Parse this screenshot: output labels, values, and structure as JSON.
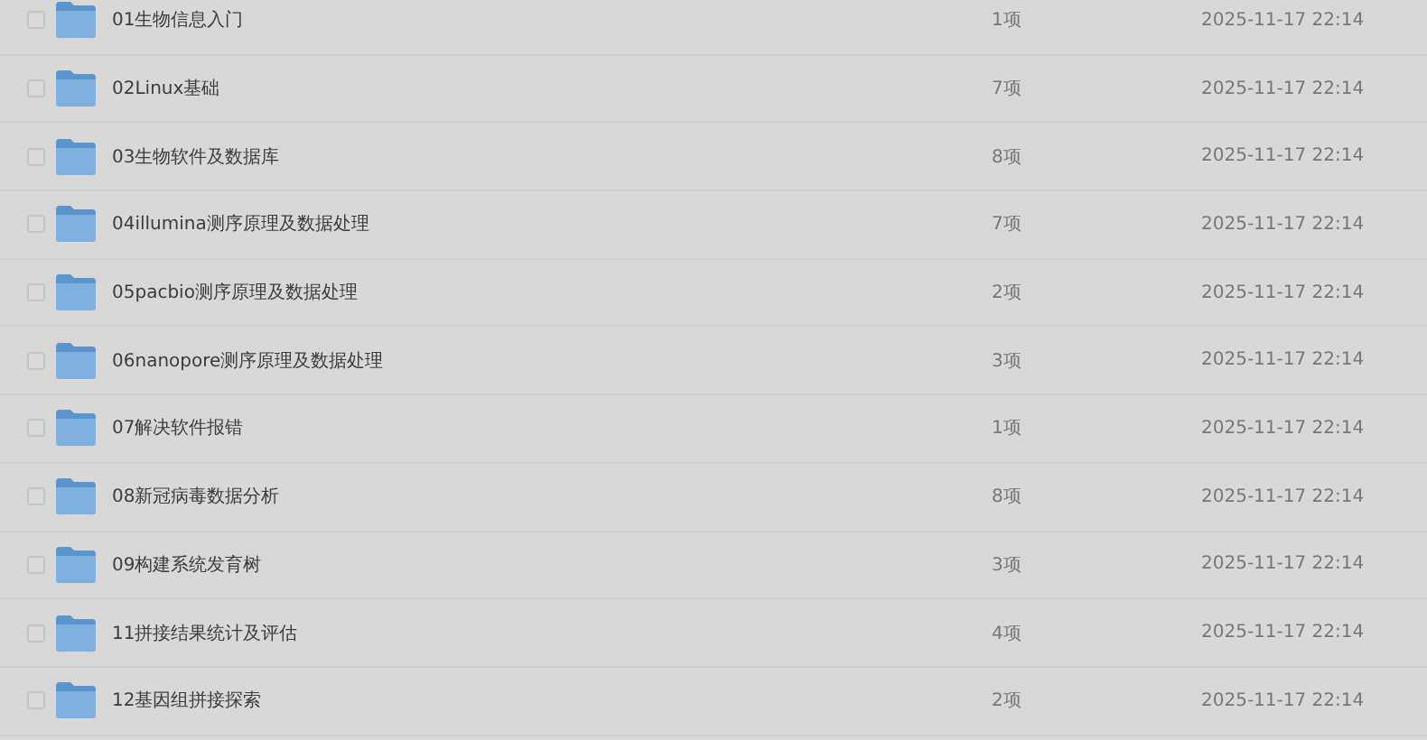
{
  "files": [
    {
      "name": "01生物信息入门",
      "count": "1项",
      "modified": "2025-11-17 22:14",
      "checked": false
    },
    {
      "name": "02Linux基础",
      "count": "7项",
      "modified": "2025-11-17 22:14",
      "checked": false
    },
    {
      "name": "03生物软件及数据库",
      "count": "8项",
      "modified": "2025-11-17 22:14",
      "checked": false
    },
    {
      "name": "04illumina测序原理及数据处理",
      "count": "7项",
      "modified": "2025-11-17 22:14",
      "checked": false
    },
    {
      "name": "05pacbio测序原理及数据处理",
      "count": "2项",
      "modified": "2025-11-17 22:14",
      "checked": false
    },
    {
      "name": "06nanopore测序原理及数据处理",
      "count": "3项",
      "modified": "2025-11-17 22:14",
      "checked": false
    },
    {
      "name": "07解决软件报错",
      "count": "1项",
      "modified": "2025-11-17 22:14",
      "checked": false
    },
    {
      "name": "08新冠病毒数据分析",
      "count": "8项",
      "modified": "2025-11-17 22:14",
      "checked": false
    },
    {
      "name": "09构建系统发育树",
      "count": "3项",
      "modified": "2025-11-17 22:14",
      "checked": false
    },
    {
      "name": "11拼接结果统计及评估",
      "count": "4项",
      "modified": "2025-11-17 22:14",
      "checked": false
    },
    {
      "name": "12基因组拼接探索",
      "count": "2项",
      "modified": "2025-11-17 22:14",
      "checked": false
    }
  ]
}
